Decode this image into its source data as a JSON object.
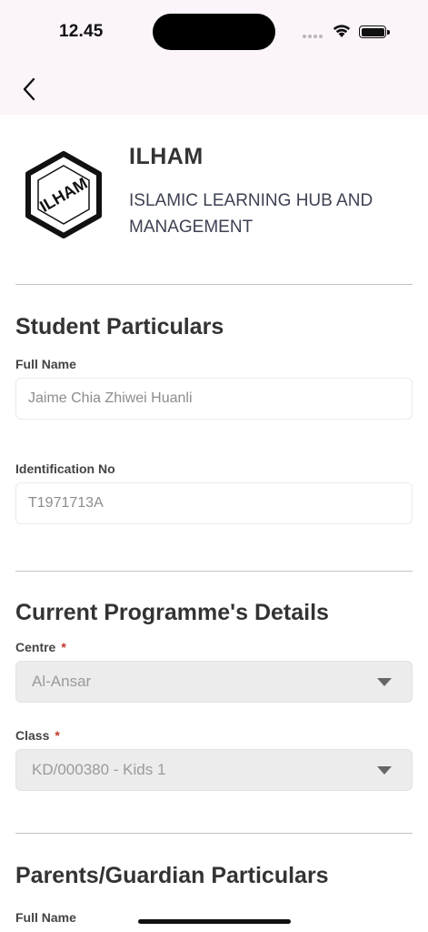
{
  "status_bar": {
    "time": "12.45"
  },
  "header": {
    "brand_name": "ILHAM",
    "brand_subtitle": "ISLAMIC LEARNING HUB AND MANAGEMENT",
    "logo_text": "ILHAM"
  },
  "student_particulars": {
    "title": "Student Particulars",
    "full_name_label": "Full Name",
    "full_name_value": "Jaime Chia Zhiwei Huanli",
    "id_label": "Identification No",
    "id_value": "T1971713A"
  },
  "programme_details": {
    "title": "Current Programme's Details",
    "centre_label": "Centre",
    "centre_value": "Al-Ansar",
    "class_label": "Class",
    "class_value": "KD/000380 - Kids 1",
    "required_mark": "*"
  },
  "guardian_particulars": {
    "title": "Parents/Guardian Particulars",
    "full_name_label": "Full Name"
  },
  "colors": {
    "header_bg": "#fcf4fb",
    "required": "#c0392b",
    "disabled_field_bg": "#ececec"
  },
  "icons": {
    "back": "chevron-left-icon",
    "dropdown": "caret-down-icon",
    "wifi": "wifi-icon",
    "battery": "battery-icon",
    "signal": "signal-icon"
  }
}
